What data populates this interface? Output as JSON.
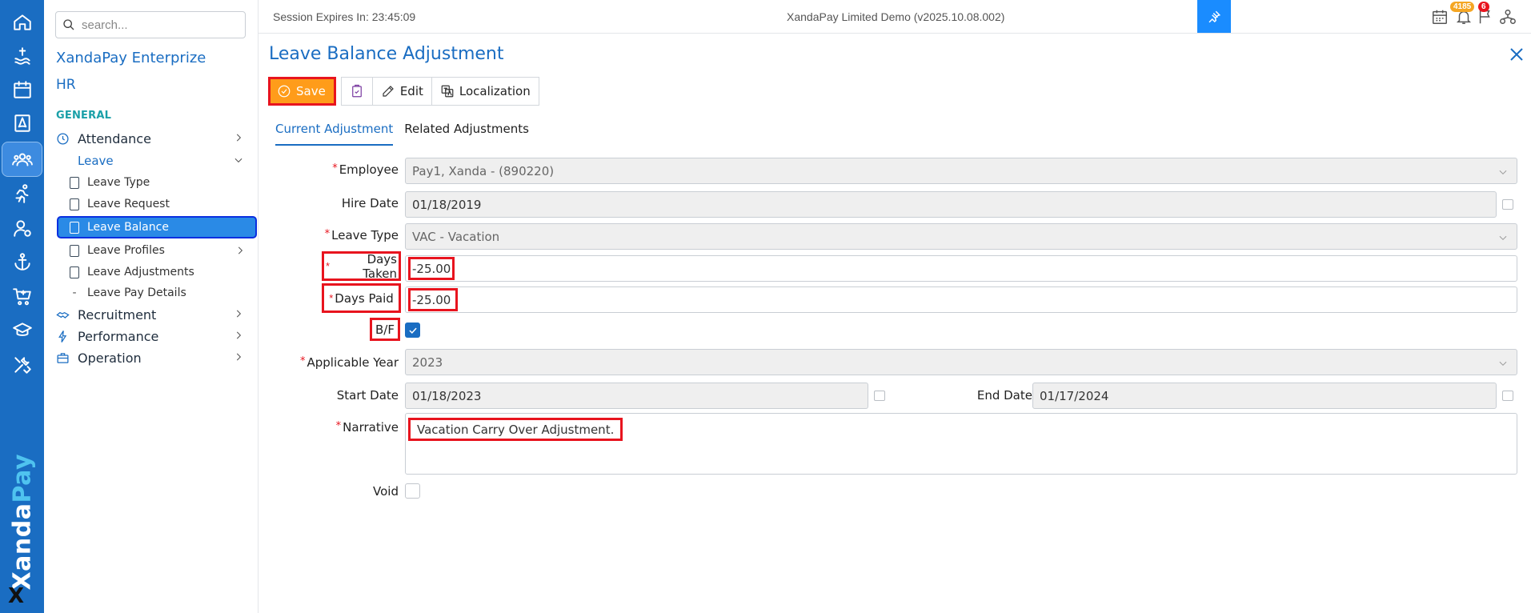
{
  "session": {
    "expires_text": "Session Expires In: 23:45:09",
    "env_text": "XandaPay Limited Demo (v2025.10.08.002)"
  },
  "badges": {
    "notifications": "4185",
    "flags": "6"
  },
  "brand": {
    "name_main": "Xanda",
    "name_accent": "Pay",
    "logo": "X"
  },
  "nav": {
    "search_placeholder": "search...",
    "org_title": "XandaPay Enterprize",
    "module": "HR",
    "section": "GENERAL",
    "items": [
      {
        "label": "Attendance",
        "icon": "clock-icon"
      },
      {
        "label": "Leave"
      },
      {
        "label": "Leave Type"
      },
      {
        "label": "Leave Request"
      },
      {
        "label": "Leave Balance"
      },
      {
        "label": "Leave Profiles"
      },
      {
        "label": "Leave Adjustments"
      },
      {
        "label": "Leave Pay Details"
      },
      {
        "label": "Recruitment",
        "icon": "handshake-icon"
      },
      {
        "label": "Performance",
        "icon": "lightning-icon"
      },
      {
        "label": "Operation",
        "icon": "briefcase-icon"
      }
    ]
  },
  "page": {
    "title": "Leave Balance Adjustment",
    "toolbar": {
      "save": "Save",
      "edit": "Edit",
      "localization": "Localization"
    },
    "tabs": [
      "Current Adjustment",
      "Related Adjustments"
    ]
  },
  "form": {
    "employee": {
      "label": "Employee",
      "value": "Pay1, Xanda - (890220)"
    },
    "hire_date": {
      "label": "Hire Date",
      "value": "01/18/2019"
    },
    "leave_type": {
      "label": "Leave Type",
      "value": "VAC - Vacation"
    },
    "days_taken": {
      "label": "Days Taken",
      "value": "-25.00"
    },
    "days_paid": {
      "label": "Days Paid",
      "value": "-25.00"
    },
    "bf": {
      "label": "B/F",
      "checked": true
    },
    "applicable_year": {
      "label": "Applicable Year",
      "value": "2023"
    },
    "start_date": {
      "label": "Start Date",
      "value": "01/18/2023"
    },
    "end_date": {
      "label": "End Date",
      "value": "01/17/2024"
    },
    "narrative": {
      "label": "Narrative",
      "value": "Vacation Carry Over Adjustment."
    },
    "void": {
      "label": "Void",
      "checked": false
    },
    "required_mark": "*"
  },
  "colors": {
    "primary": "#1a6dc2",
    "save": "#ff9c1a",
    "highlight": "#e8141e"
  }
}
